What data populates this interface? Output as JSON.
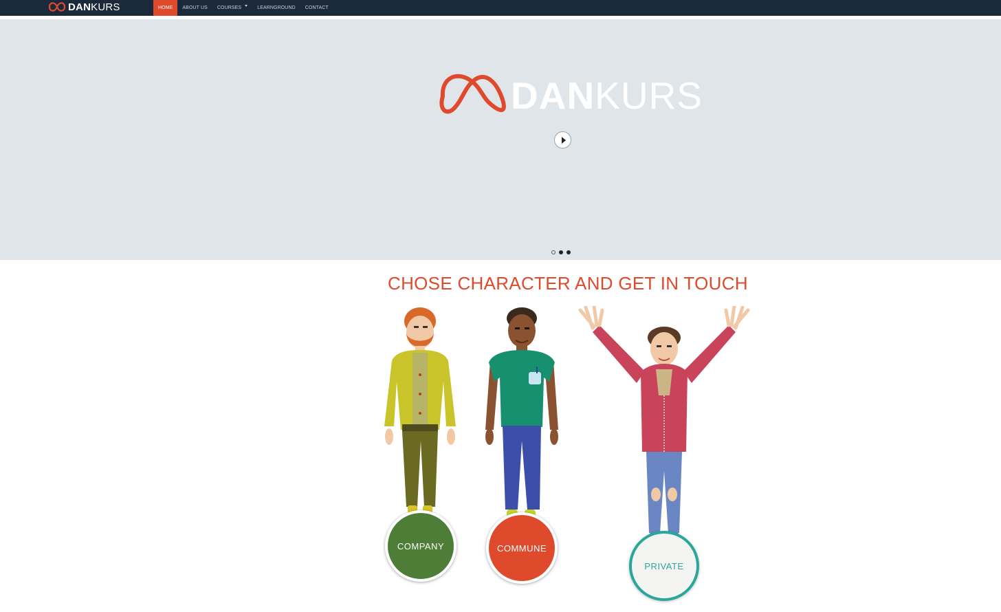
{
  "brand": {
    "name_bold": "DAN",
    "name_light": "KURS",
    "accent_color": "#e04a2c",
    "nav_background": "#1b2a3a"
  },
  "nav": {
    "items": [
      {
        "label": "HOME",
        "active": true
      },
      {
        "label": "ABOUT US",
        "active": false
      },
      {
        "label": "COURSES",
        "active": false,
        "has_dropdown": true
      },
      {
        "label": "LEARNGROUND",
        "active": false
      },
      {
        "label": "CONTACT",
        "active": false
      }
    ]
  },
  "hero": {
    "logo_bold": "DAN",
    "logo_light": "KURS",
    "play_icon": "play-icon",
    "slides_total": 3,
    "slide_current": 1
  },
  "section": {
    "title": "CHOSE CHARACTER AND GET IN TOUCH",
    "characters": [
      {
        "label": "COMPANY",
        "color": "#4e7d37"
      },
      {
        "label": "COMMUNE",
        "color": "#e04a2c"
      },
      {
        "label": "PRIVATE",
        "color": "#2aa69a"
      }
    ]
  }
}
